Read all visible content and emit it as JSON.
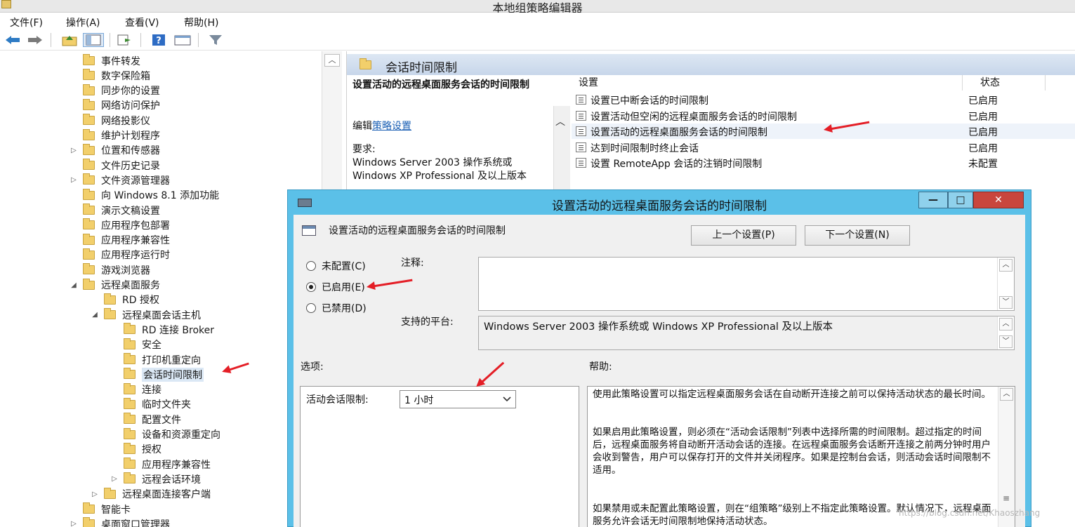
{
  "window": {
    "title": "本地组策略编辑器"
  },
  "menu": [
    "文件(F)",
    "操作(A)",
    "查看(V)",
    "帮助(H)"
  ],
  "toolbar": [
    "back-icon",
    "forward-icon",
    "up-folder-icon",
    "show-hide-tree-icon",
    "export-list-icon",
    "help-icon",
    "properties-icon",
    "filter-icon"
  ],
  "tree": {
    "items": [
      {
        "label": "事件转发"
      },
      {
        "label": "数字保险箱"
      },
      {
        "label": "同步你的设置"
      },
      {
        "label": "网络访问保护"
      },
      {
        "label": "网络投影仪"
      },
      {
        "label": "维护计划程序"
      },
      {
        "label": "位置和传感器",
        "expander": "▷"
      },
      {
        "label": "文件历史记录"
      },
      {
        "label": "文件资源管理器",
        "expander": "▷"
      },
      {
        "label": "向 Windows 8.1 添加功能"
      },
      {
        "label": "演示文稿设置"
      },
      {
        "label": "应用程序包部署"
      },
      {
        "label": "应用程序兼容性"
      },
      {
        "label": "应用程序运行时"
      },
      {
        "label": "游戏浏览器"
      },
      {
        "label": "远程桌面服务",
        "expander": "◢"
      },
      {
        "label": "RD 授权"
      },
      {
        "label": "远程桌面会话主机",
        "expander": "◢"
      },
      {
        "label": "RD 连接 Broker"
      },
      {
        "label": "安全"
      },
      {
        "label": "打印机重定向"
      },
      {
        "label": "会话时间限制",
        "selected": true
      },
      {
        "label": "连接"
      },
      {
        "label": "临时文件夹"
      },
      {
        "label": "配置文件"
      },
      {
        "label": "设备和资源重定向"
      },
      {
        "label": "授权"
      },
      {
        "label": "应用程序兼容性"
      },
      {
        "label": "远程会话环境",
        "expander": "▷"
      },
      {
        "label": "远程桌面连接客户端",
        "expander": "▷"
      },
      {
        "label": "智能卡"
      },
      {
        "label": "桌面窗口管理器",
        "expander": "▷"
      }
    ]
  },
  "right": {
    "header": "会话时间限制",
    "desc_title": "设置活动的远程桌面服务会话的时间限制",
    "edit_prefix": "编辑",
    "edit_link": "策略设置",
    "req_label": "要求:",
    "req_text": "Windows Server 2003 操作系统或 Windows XP Professional 及以上版本",
    "columns": {
      "setting": "设置",
      "state": "状态"
    },
    "rows": [
      {
        "name": "设置已中断会话的时间限制",
        "state": "已启用"
      },
      {
        "name": "设置活动但空闲的远程桌面服务会话的时间限制",
        "state": "已启用"
      },
      {
        "name": "设置活动的远程桌面服务会话的时间限制",
        "state": "已启用"
      },
      {
        "name": "达到时间限制时终止会话",
        "state": "已启用"
      },
      {
        "name": "设置 RemoteApp 会话的注销时间限制",
        "state": "未配置"
      }
    ]
  },
  "dialog": {
    "title": "设置活动的远程桌面服务会话的时间限制",
    "setting_name": "设置活动的远程桌面服务会话的时间限制",
    "prev": "上一个设置(P)",
    "next": "下一个设置(N)",
    "minimize": "—",
    "maximize": "□",
    "close": "✕",
    "radios": [
      {
        "label": "未配置(C)",
        "checked": false
      },
      {
        "label": "已启用(E)",
        "checked": true
      },
      {
        "label": "已禁用(D)",
        "checked": false
      }
    ],
    "comment_label": "注释:",
    "platform_label": "支持的平台:",
    "platform_value": "Windows Server 2003 操作系统或 Windows XP Professional 及以上版本",
    "options_label": "选项:",
    "help_label": "帮助:",
    "option_field_label": "活动会话限制:",
    "option_value": "1 小时",
    "help_paragraphs": [
      "使用此策略设置可以指定远程桌面服务会话在自动断开连接之前可以保持活动状态的最长时间。",
      "如果启用此策略设置，则必须在“活动会话限制”列表中选择所需的时间限制。超过指定的时间后，远程桌面服务将自动断开活动会话的连接。在远程桌面服务会话断开连接之前两分钟时用户会收到警告，用户可以保存打开的文件并关闭程序。如果是控制台会话，则活动会话时间限制不适用。",
      "如果禁用或未配置此策略设置，则在“组策略”级别上不指定此策略设置。默认情况下，远程桌面服务允许会话无时间限制地保持活动状态。"
    ]
  },
  "watermark": "https://blog.csdn.net/Khaoszhang",
  "colors": {
    "accent": "#5bc0e8",
    "arrow": "#e41e26",
    "folder": "#f2cf6b"
  }
}
